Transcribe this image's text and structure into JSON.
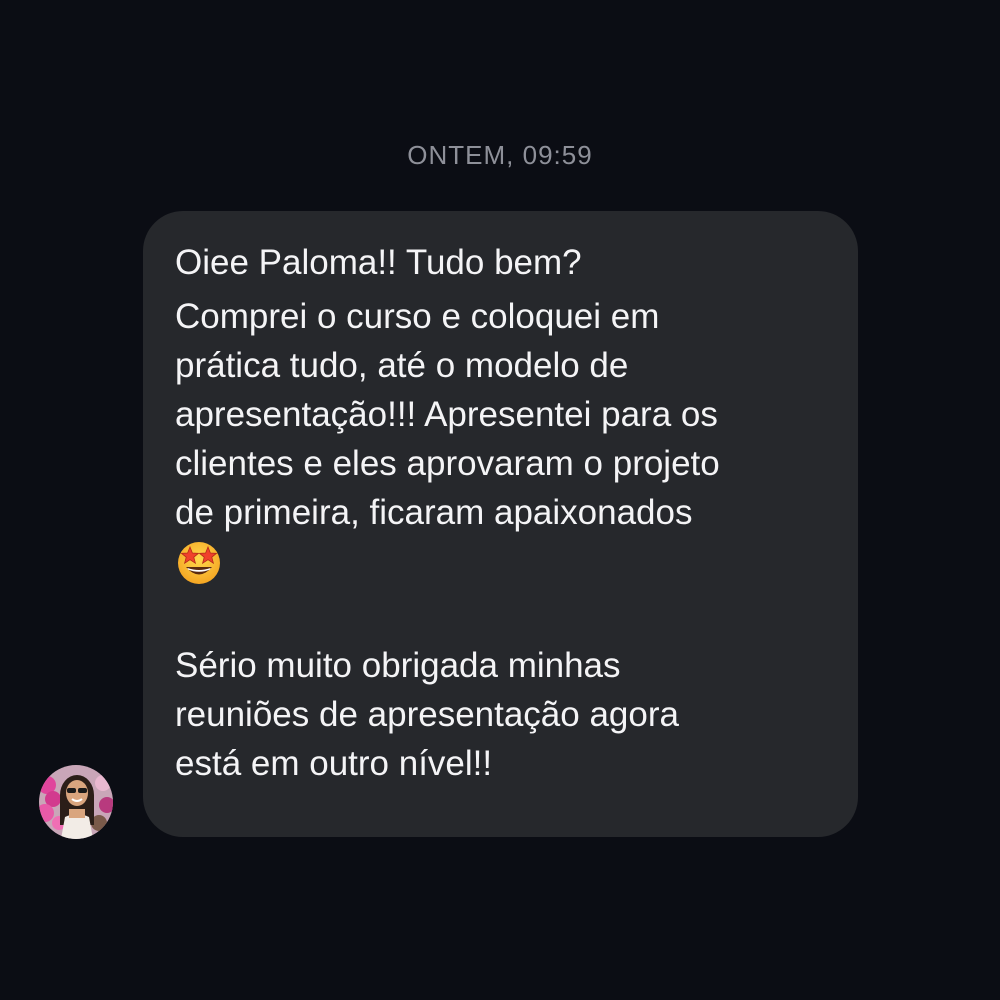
{
  "chat": {
    "timestamp": "ONTEM, 09:59",
    "message": {
      "greeting": "Oiee Paloma!! Tudo bem?",
      "paragraph1_lines": [
        "Comprei o curso e coloquei em",
        "prática tudo, até o modelo de",
        "apresentação!!! Apresentei para os",
        "clientes e eles aprovaram o projeto",
        "de primeira, ficaram apaixonados"
      ],
      "emoji": "star-struck-emoji-icon",
      "paragraph2_lines": [
        "Sério muito obrigada minhas",
        "reuniões de apresentação agora",
        "está em outro nível!!"
      ]
    },
    "sender_avatar": "avatar-photo"
  },
  "colors": {
    "background": "#0b0d14",
    "bubble": "#26282c",
    "text": "#f4f4f6",
    "timestamp": "#8e9099"
  }
}
